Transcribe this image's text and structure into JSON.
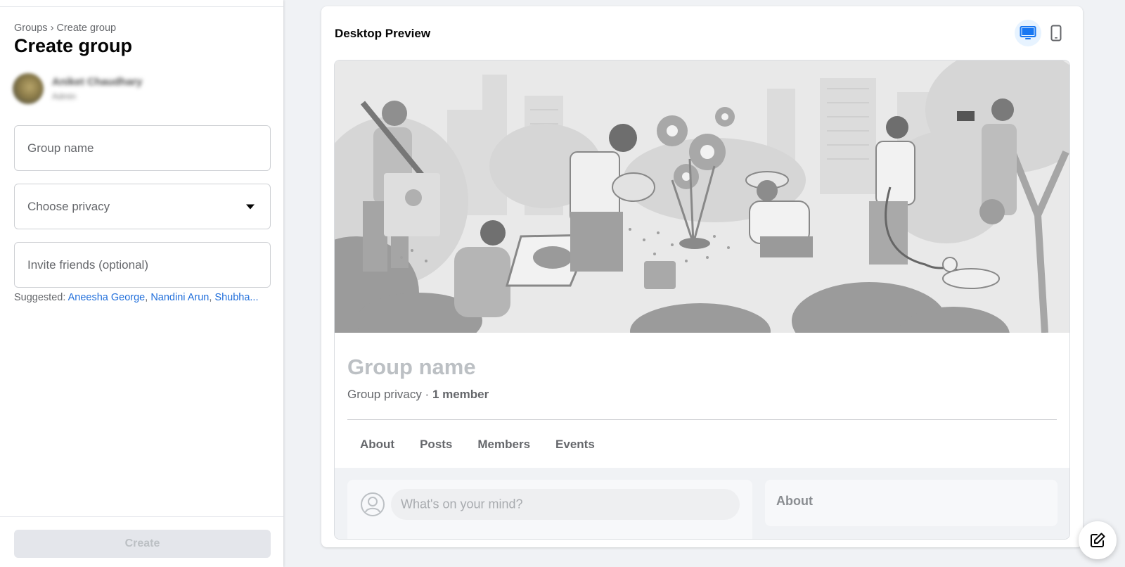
{
  "breadcrumb": {
    "root": "Groups",
    "separator": " › ",
    "current": "Create group"
  },
  "page_title": "Create group",
  "profile": {
    "name": "Aniket Chaudhary",
    "role": "Admin"
  },
  "form": {
    "group_name_placeholder": "Group name",
    "privacy_placeholder": "Choose privacy",
    "invite_placeholder": "Invite friends (optional)",
    "suggested_label": "Suggested:",
    "suggested_friends": [
      "Aneesha George",
      "Nandini Arun",
      "Shubha..."
    ]
  },
  "create_button": "Create",
  "preview": {
    "title": "Desktop Preview",
    "group_name": "Group name",
    "privacy_text": "Group privacy",
    "separator": " · ",
    "members_text": "1 member",
    "tabs": [
      "About",
      "Posts",
      "Members",
      "Events"
    ],
    "composer_placeholder": "What's on your mind?",
    "about_heading": "About"
  },
  "icons": {
    "desktop": "desktop-icon",
    "mobile": "mobile-icon",
    "compose": "compose-icon",
    "dropdown": "caret-down-icon"
  },
  "colors": {
    "accent": "#216fdb",
    "active_device_bg": "#e7f3ff",
    "disabled_button": "#e4e6eb"
  }
}
